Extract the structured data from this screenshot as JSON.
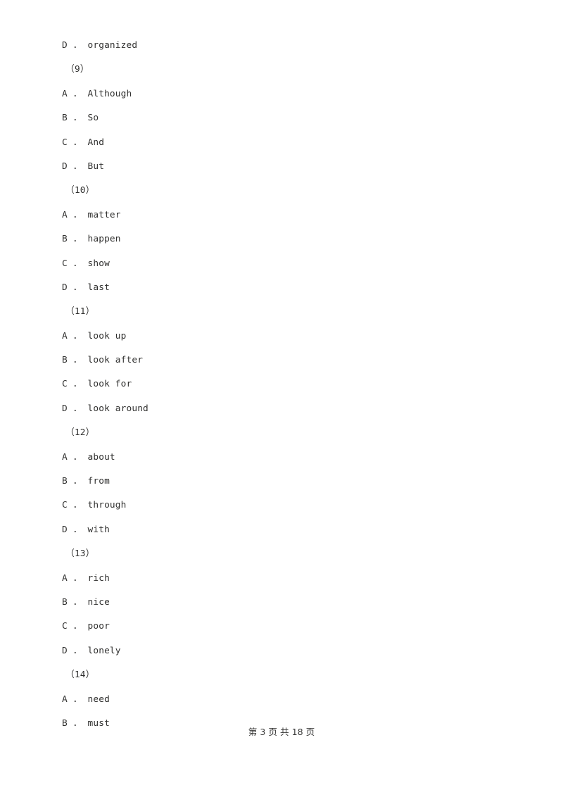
{
  "document": {
    "background_color": "#ffffff",
    "text_color": "#30302f",
    "footer_color": "#3a3a39"
  },
  "body_lines": [
    {
      "type": "option",
      "text": "D ． organized"
    },
    {
      "type": "question",
      "text": "（9）"
    },
    {
      "type": "option",
      "text": "A ． Although"
    },
    {
      "type": "option",
      "text": "B ． So"
    },
    {
      "type": "option",
      "text": "C ． And"
    },
    {
      "type": "option",
      "text": "D ． But"
    },
    {
      "type": "question",
      "text": "（10）"
    },
    {
      "type": "option",
      "text": "A ． matter"
    },
    {
      "type": "option",
      "text": "B ． happen"
    },
    {
      "type": "option",
      "text": "C ． show"
    },
    {
      "type": "option",
      "text": "D ． last"
    },
    {
      "type": "question",
      "text": "（11）"
    },
    {
      "type": "option",
      "text": "A ． look up"
    },
    {
      "type": "option",
      "text": "B ． look after"
    },
    {
      "type": "option",
      "text": "C ． look for"
    },
    {
      "type": "option",
      "text": "D ． look around"
    },
    {
      "type": "question",
      "text": "（12）"
    },
    {
      "type": "option",
      "text": "A ． about"
    },
    {
      "type": "option",
      "text": "B ． from"
    },
    {
      "type": "option",
      "text": "C ． through"
    },
    {
      "type": "option",
      "text": "D ． with"
    },
    {
      "type": "question",
      "text": "（13）"
    },
    {
      "type": "option",
      "text": "A ． rich"
    },
    {
      "type": "option",
      "text": "B ． nice"
    },
    {
      "type": "option",
      "text": "C ． poor"
    },
    {
      "type": "option",
      "text": "D ． lonely"
    },
    {
      "type": "question",
      "text": "（14）"
    },
    {
      "type": "option",
      "text": "A ． need"
    },
    {
      "type": "option",
      "text": "B ． must"
    }
  ],
  "footer": {
    "text": "第 3 页 共 18 页",
    "current_page": "3",
    "total_pages": "18"
  }
}
